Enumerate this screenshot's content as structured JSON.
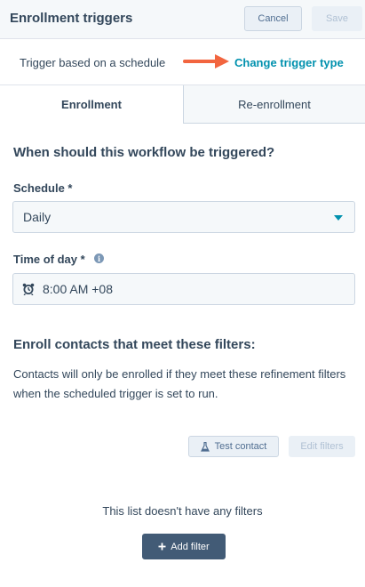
{
  "header": {
    "title": "Enrollment triggers",
    "cancel_label": "Cancel",
    "save_label": "Save"
  },
  "trigger": {
    "label": "Trigger based on a schedule",
    "change_link": "Change trigger type",
    "arrow_icon": "arrow-right-icon"
  },
  "tabs": [
    {
      "label": "Enrollment",
      "active": true
    },
    {
      "label": "Re-enrollment",
      "active": false
    }
  ],
  "main": {
    "question": "When should this workflow be triggered?",
    "schedule": {
      "label": "Schedule *",
      "value": "Daily"
    },
    "time_of_day": {
      "label": "Time of day *",
      "value": "8:00 AM +08",
      "icon": "alarm-clock-icon",
      "info_icon": "info-icon"
    },
    "filters": {
      "title": "Enroll contacts that meet these filters:",
      "description": "Contacts will only be enrolled if they meet these refinement filters when the scheduled trigger is set to run.",
      "test_contact_label": "Test contact",
      "edit_filters_label": "Edit filters",
      "empty_text": "This list doesn't have any filters",
      "add_filter_label": "Add filter"
    }
  },
  "colors": {
    "accent": "#0091ae",
    "text": "#33475b",
    "arrow": "#f2653f",
    "primary_button": "#425b76"
  }
}
